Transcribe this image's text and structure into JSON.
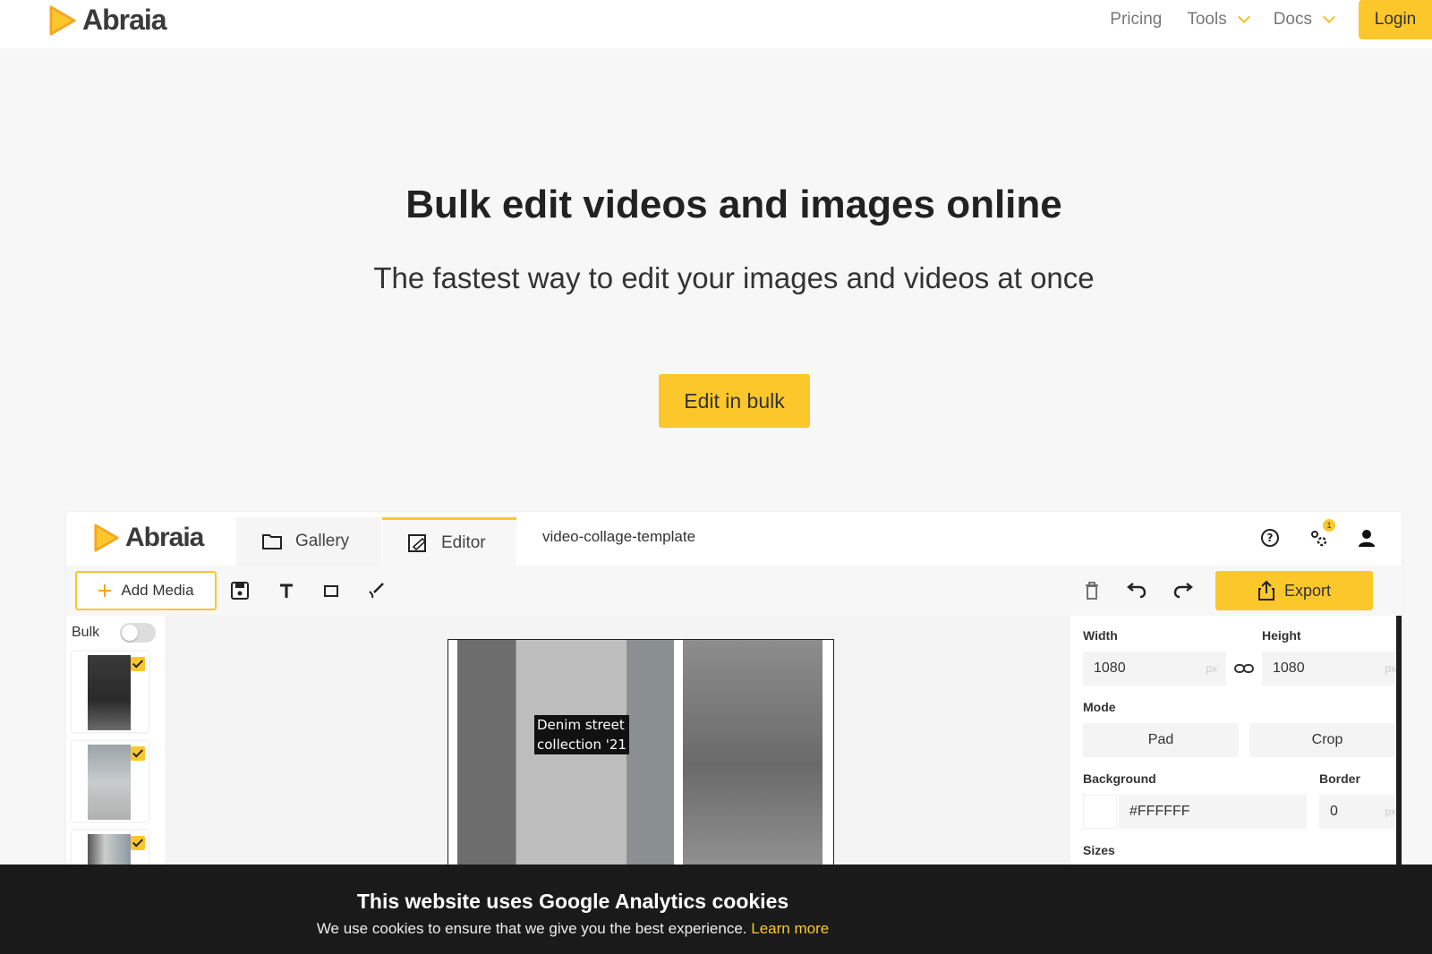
{
  "brand": {
    "name": "Abraia",
    "accent": "#fcc72b"
  },
  "nav": {
    "items": [
      {
        "label": "Pricing",
        "dropdown": false
      },
      {
        "label": "Tools",
        "dropdown": true
      },
      {
        "label": "Docs",
        "dropdown": true
      }
    ],
    "login": "Login"
  },
  "hero": {
    "title": "Bulk edit videos and images online",
    "subtitle": "The fastest way to edit your images and videos at once",
    "cta": "Edit in bulk"
  },
  "app": {
    "tabs": {
      "gallery": "Gallery",
      "editor": "Editor"
    },
    "filename": "video-collage-template",
    "notification_count": "1",
    "toolbar": {
      "add_media": "Add Media",
      "export": "Export"
    },
    "bulk": {
      "label": "Bulk",
      "enabled": false
    },
    "canvas": {
      "overlay_text_line1": "Denim street",
      "overlay_text_line2": "collection '21"
    },
    "props": {
      "width_label": "Width",
      "height_label": "Height",
      "width_value": "1080",
      "height_value": "1080",
      "unit": "px",
      "mode_label": "Mode",
      "mode_options": [
        "Pad",
        "Crop"
      ],
      "background_label": "Background",
      "background_value": "#FFFFFF",
      "border_label": "Border",
      "border_value": "0",
      "sizes_label": "Sizes"
    }
  },
  "cookie": {
    "title": "This website uses Google Analytics cookies",
    "text": "We use cookies to ensure that we give you the best experience.",
    "link": "Learn more"
  }
}
